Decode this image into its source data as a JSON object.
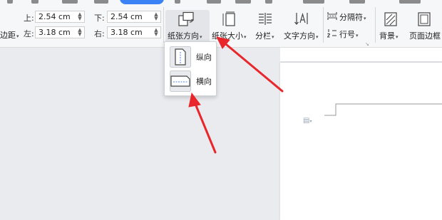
{
  "margins": {
    "top_label": "上:",
    "top_value": "2.54 cm",
    "bottom_label": "下:",
    "bottom_value": "2.54 cm",
    "left_label": "左:",
    "left_value": "3.18 cm",
    "right_label": "右:",
    "right_value": "3.18 cm",
    "margin_button_label": "边距"
  },
  "toolbar": {
    "orientation_label": "纸张方向",
    "size_label": "纸张大小",
    "columns_label": "分栏",
    "text_direction_label": "文字方向",
    "breaks_label": "分隔符",
    "line_numbers_label": "行号",
    "background_label": "背景",
    "page_border_label": "页面边框"
  },
  "orientation_menu": {
    "portrait_label": "纵向",
    "landscape_label": "横向"
  },
  "colors": {
    "active_tab": "#3b82f6",
    "arrow": "#e8262b"
  }
}
